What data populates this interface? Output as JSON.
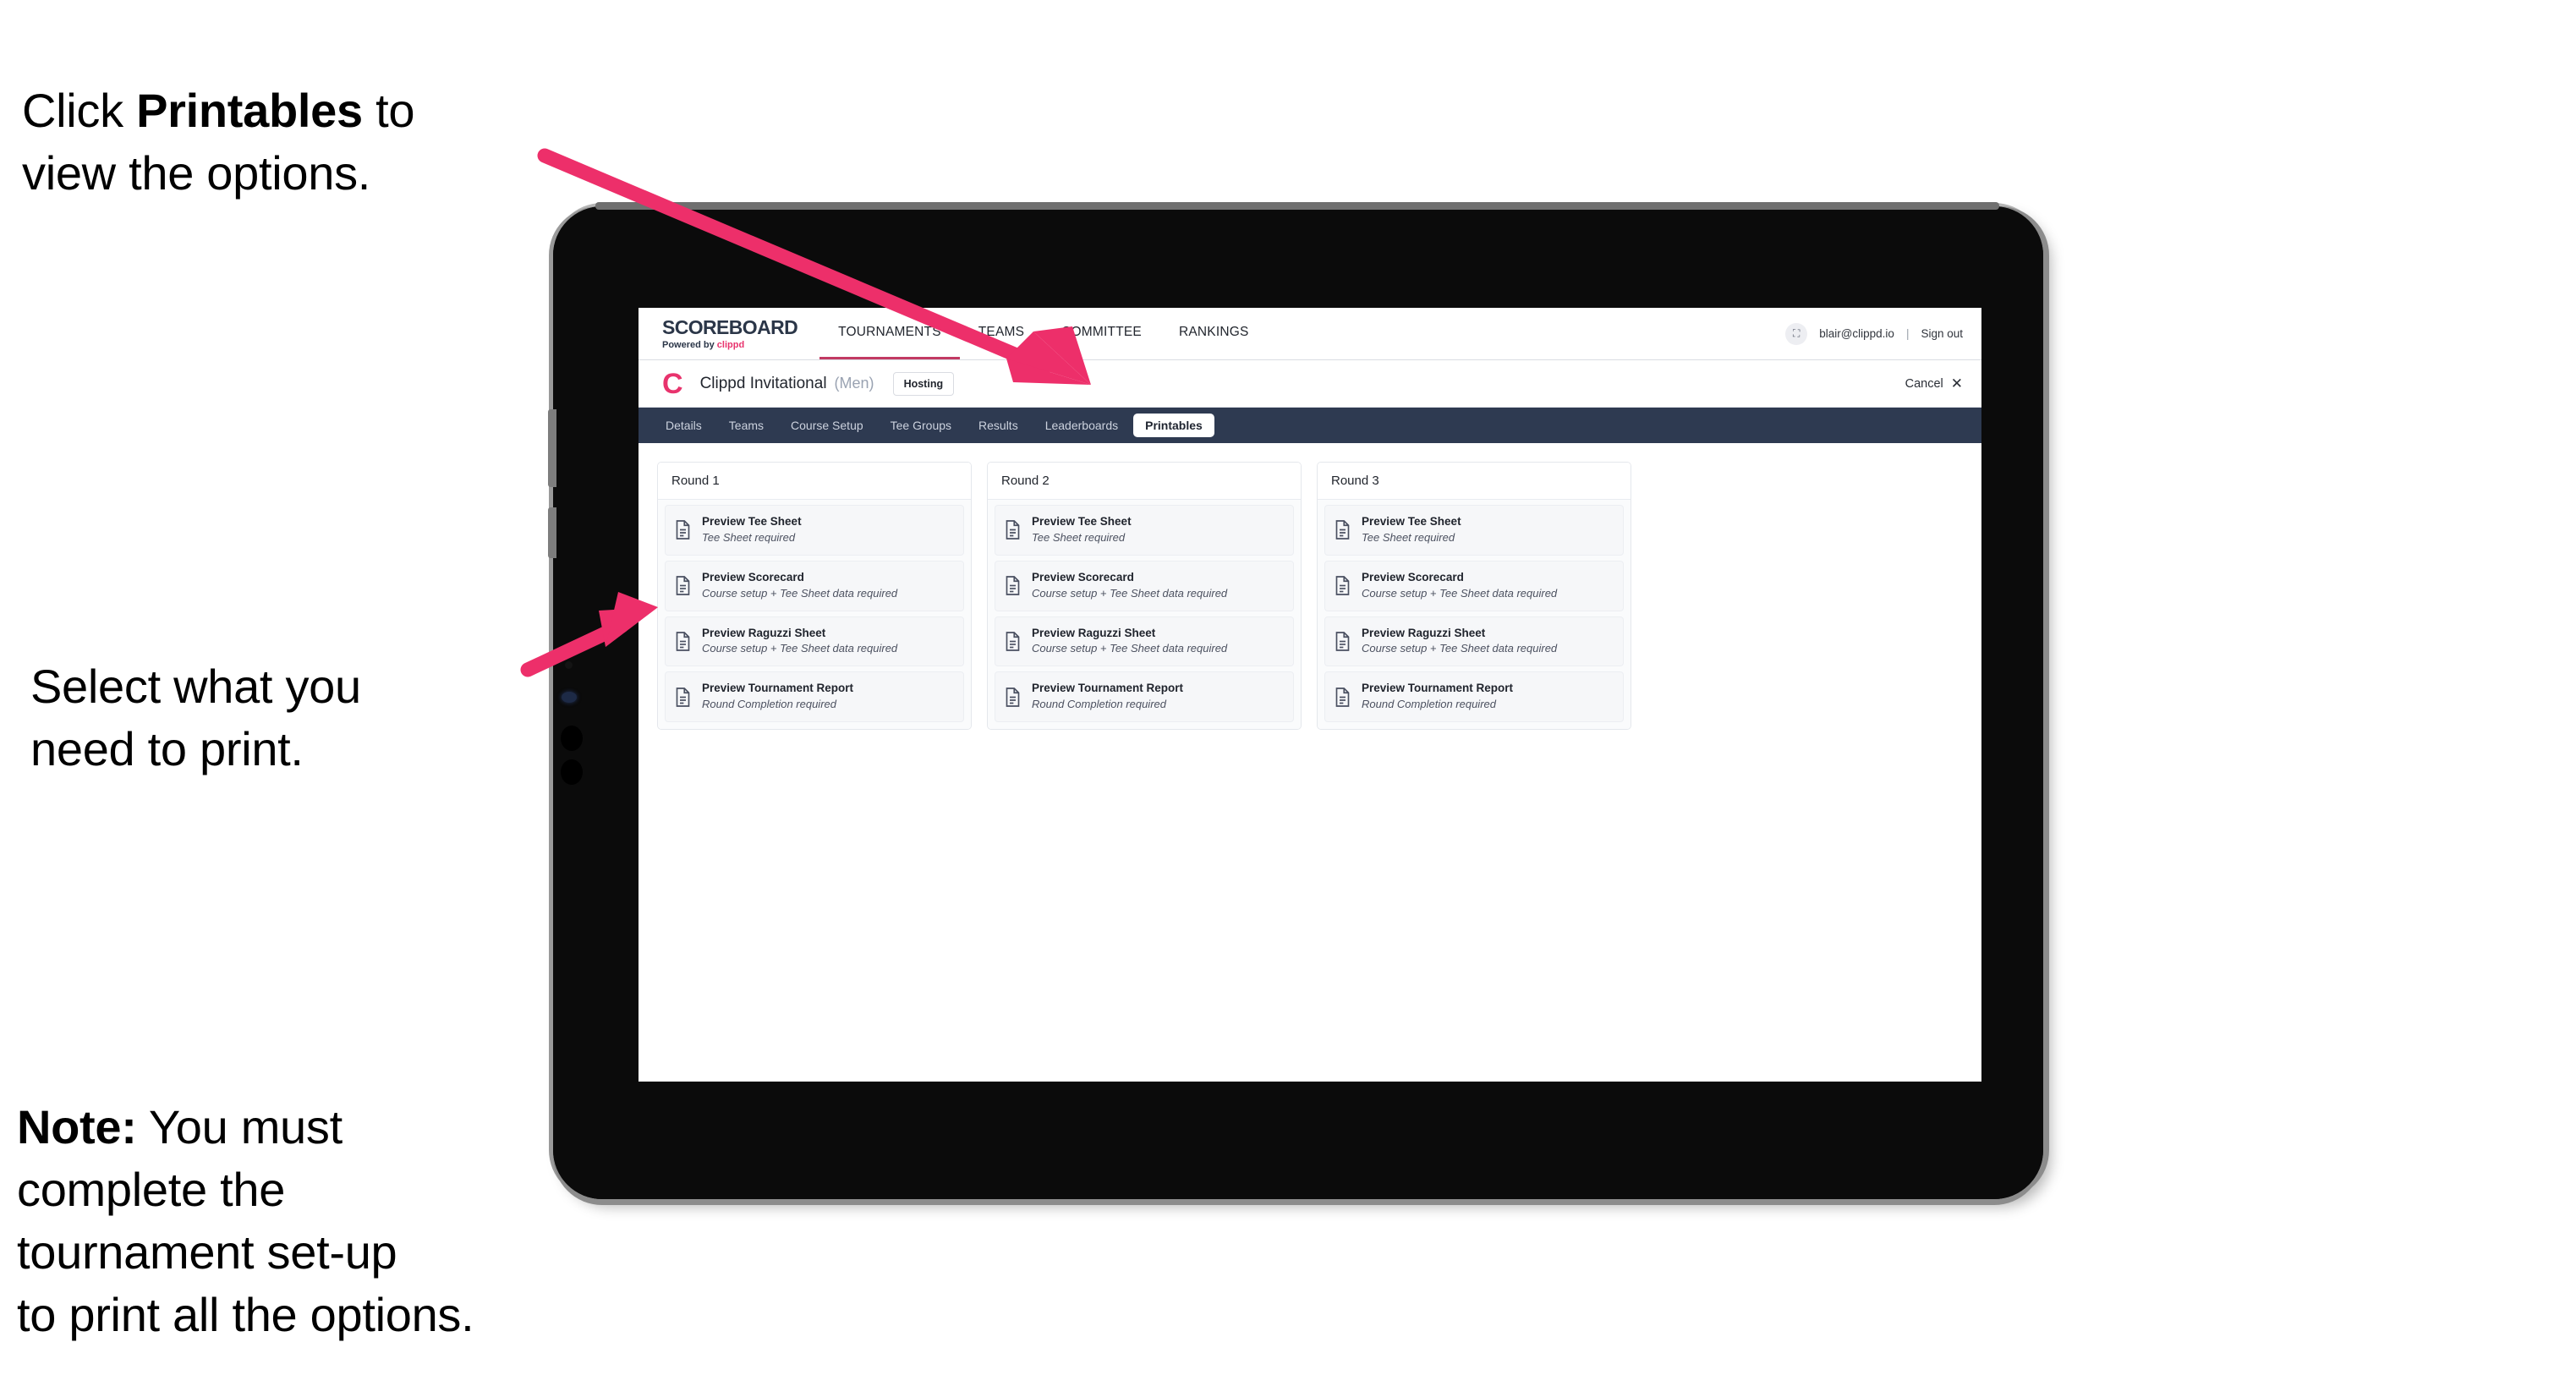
{
  "annotations": {
    "click_printables": {
      "pre": "Click ",
      "bold": "Printables",
      "post": " to\nview the options."
    },
    "select_print": "Select what you\n need to print.",
    "note": {
      "bold": "Note:",
      "rest": " You must\ncomplete the\ntournament set-up\nto print all the options."
    }
  },
  "colors": {
    "accent_pink": "#e8336d",
    "arrow_pink": "#ed2f6a",
    "tabstrip_navy": "#2e3a51",
    "tab_active_underline": "#c23a63",
    "device_black": "#0d0d0d",
    "device_edge_gray": "#8c8c8c"
  },
  "app": {
    "topnav": {
      "brand_title": "SCOREBOARD",
      "brand_sub_prefix": "Powered by ",
      "brand_sub_accent": "clippd",
      "links": [
        {
          "label": "TOURNAMENTS",
          "active": true
        },
        {
          "label": "TEAMS",
          "active": false
        },
        {
          "label": "COMMITTEE",
          "active": false
        },
        {
          "label": "RANKINGS",
          "active": false
        }
      ],
      "avatar_glyph": "⛶",
      "user_email": "blair@clippd.io",
      "divider": "|",
      "sign_out": "Sign out"
    },
    "tournament_bar": {
      "logo_letter": "C",
      "name": "Clippd Invitational",
      "gender": "(Men)",
      "status_badge": "Hosting",
      "cancel_label": "Cancel",
      "cancel_icon": "✕"
    },
    "tabs": [
      {
        "label": "Details",
        "active": false
      },
      {
        "label": "Teams",
        "active": false
      },
      {
        "label": "Course Setup",
        "active": false
      },
      {
        "label": "Tee Groups",
        "active": false
      },
      {
        "label": "Results",
        "active": false
      },
      {
        "label": "Leaderboards",
        "active": false
      },
      {
        "label": "Printables",
        "active": true
      }
    ],
    "rounds": [
      {
        "title": "Round 1",
        "items": [
          {
            "title": "Preview Tee Sheet",
            "sub": "Tee Sheet required"
          },
          {
            "title": "Preview Scorecard",
            "sub": "Course setup + Tee Sheet data required"
          },
          {
            "title": "Preview Raguzzi Sheet",
            "sub": "Course setup + Tee Sheet data required"
          },
          {
            "title": "Preview Tournament Report",
            "sub": "Round Completion required"
          }
        ]
      },
      {
        "title": "Round 2",
        "items": [
          {
            "title": "Preview Tee Sheet",
            "sub": "Tee Sheet required"
          },
          {
            "title": "Preview Scorecard",
            "sub": "Course setup + Tee Sheet data required"
          },
          {
            "title": "Preview Raguzzi Sheet",
            "sub": "Course setup + Tee Sheet data required"
          },
          {
            "title": "Preview Tournament Report",
            "sub": "Round Completion required"
          }
        ]
      },
      {
        "title": "Round 3",
        "items": [
          {
            "title": "Preview Tee Sheet",
            "sub": "Tee Sheet required"
          },
          {
            "title": "Preview Scorecard",
            "sub": "Course setup + Tee Sheet data required"
          },
          {
            "title": "Preview Raguzzi Sheet",
            "sub": "Course setup + Tee Sheet data required"
          },
          {
            "title": "Preview Tournament Report",
            "sub": "Round Completion required"
          }
        ]
      }
    ]
  }
}
